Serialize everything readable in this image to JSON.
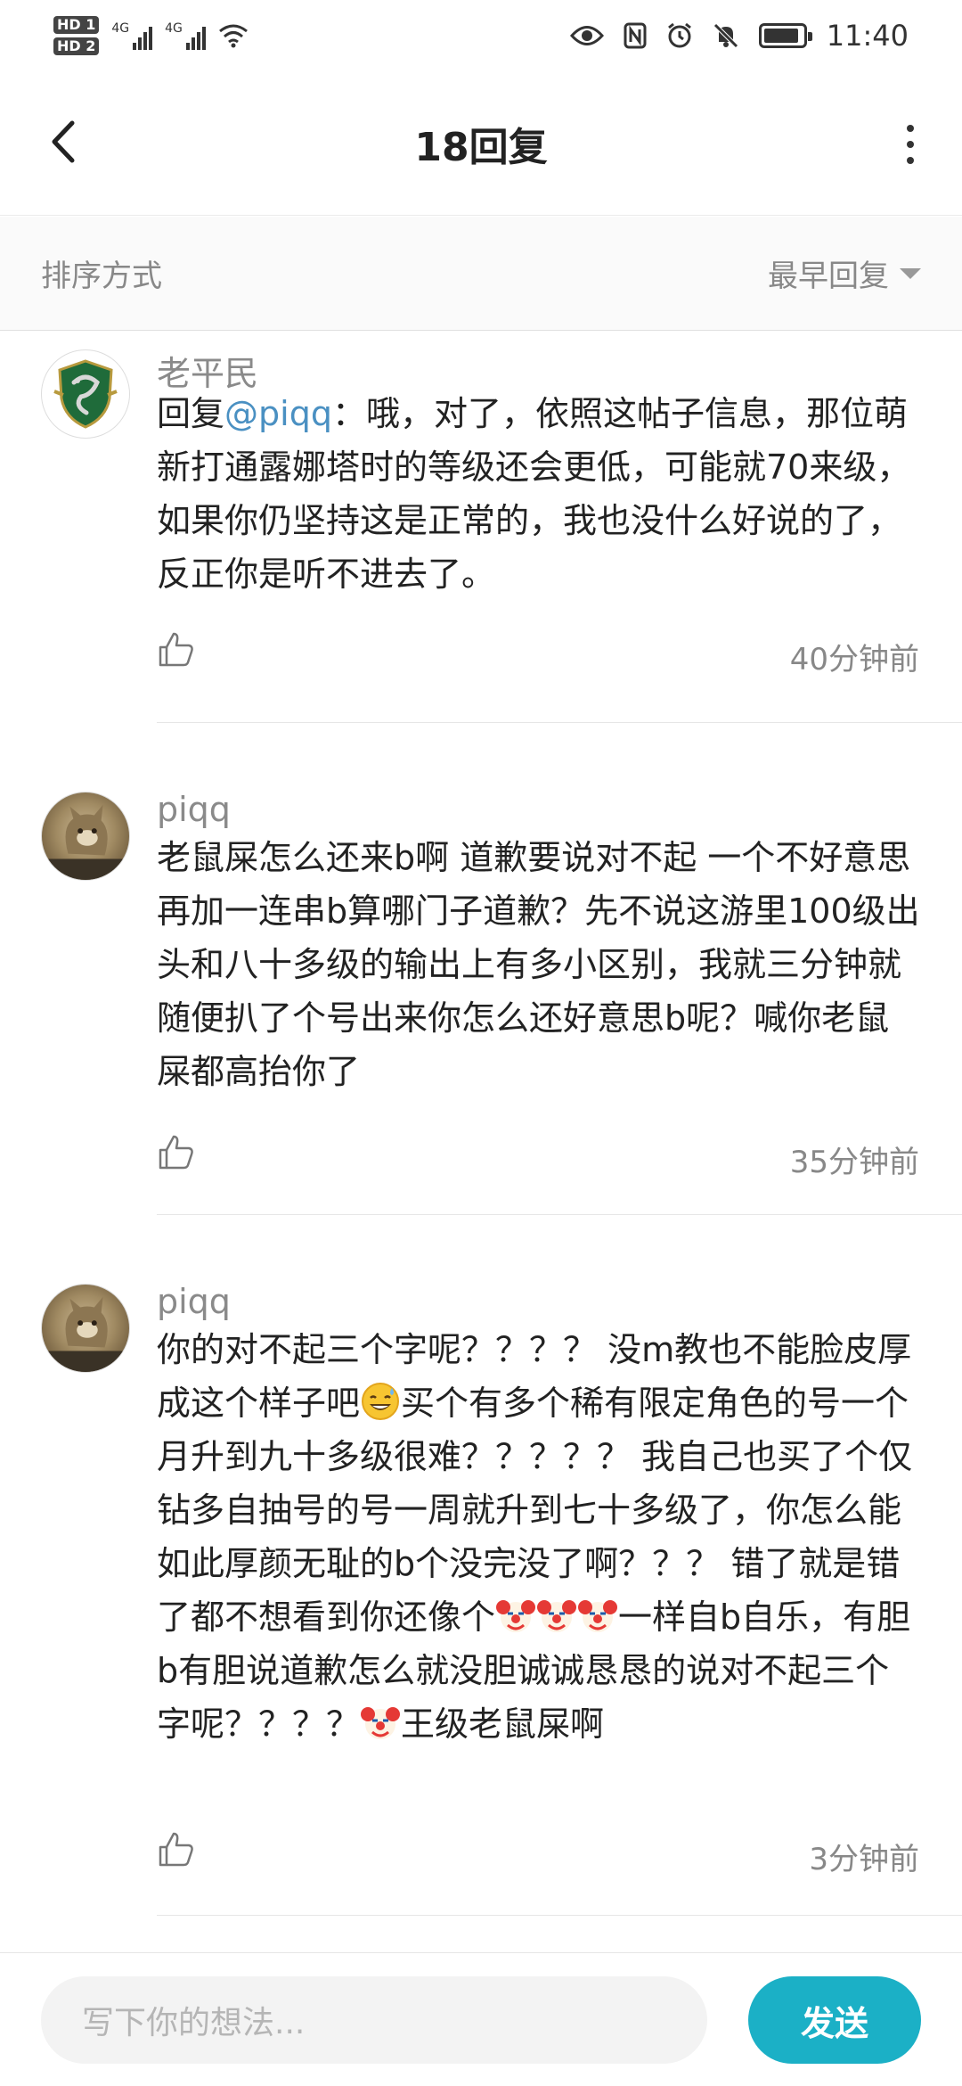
{
  "status_bar": {
    "hd1": "HD 1",
    "hd2": "HD 2",
    "net1": "4G",
    "net2": "4G",
    "time": "11:40",
    "battery_level": 0.9
  },
  "header": {
    "title": "18回复"
  },
  "sort": {
    "label": "排序方式",
    "value": "最早回复"
  },
  "comments": [
    {
      "author": "老平民",
      "reply_prefix": "回复",
      "mention": "@piqq",
      "text": "：哦，对了，依照这帖子信息，那位萌新打通露娜塔时的等级还会更低，可能就70来级，如果你仍坚持这是正常的，我也没什么好说的了，反正你是听不进去了。",
      "time": "40分钟前",
      "avatar_icon": "slytherin-crest-avatar"
    },
    {
      "author": "piqq",
      "text": "老鼠屎怎么还来b啊 道歉要说对不起 一个不好意思再加一连串b算哪门子道歉？先不说这游里100级出头和八十多级的输出上有多小区别，我就三分钟就随便扒了个号出来你怎么还好意思b呢？喊你老鼠屎都高抬你了",
      "time": "35分钟前",
      "avatar_icon": "cat-avatar"
    },
    {
      "author": "piqq",
      "text_a": "你的对不起三个字呢？？？？ 没m教也不能脸皮厚成这个样子吧",
      "text_b": "买个有多个稀有限定角色的号一个月升到九十多级很难？？？？？ 我自己也买了个仅钻多自抽号的号一周就升到七十多级了，你怎么能如此厚颜无耻的b个没完没了啊？？？ 错了就是错了都不想看到你还像个",
      "text_c": "一样自b自乐，有胆b有胆说道歉怎么就没胆诚诚恳恳的说对不起三个字呢？？？？",
      "text_d": "王级老鼠屎啊",
      "time": "3分钟前",
      "avatar_icon": "cat-avatar"
    }
  ],
  "composer": {
    "placeholder": "写下你的想法...",
    "send_label": "发送"
  },
  "icons": {
    "back": "back-arrow-icon",
    "more": "more-vertical-icon",
    "like": "thumbs-up-icon",
    "eye": "eye-icon",
    "nfc": "nfc-icon",
    "alarm": "alarm-icon",
    "mute": "bell-off-icon",
    "wifi": "wifi-icon",
    "emoji_sweat": "sweat-smile-emoji",
    "emoji_clown": "clown-emoji"
  },
  "colors": {
    "accent": "#1bb0c6",
    "mention": "#4a90c2",
    "muted_text": "#888888"
  }
}
